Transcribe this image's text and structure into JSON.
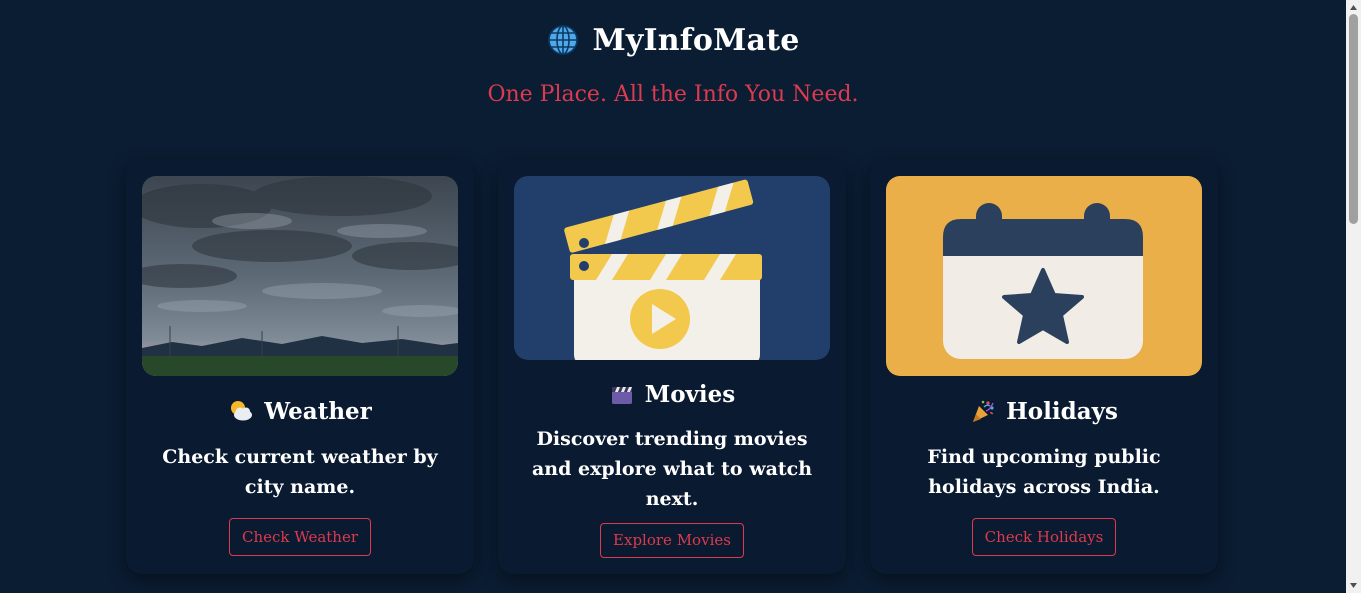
{
  "header": {
    "icon": "globe-icon",
    "title": "MyInfoMate",
    "tagline": "One Place. All the Info You Need."
  },
  "cards": [
    {
      "image": "cloudy-sky-landscape-photo",
      "icon": "sun-behind-cloud-icon",
      "title": "Weather",
      "description": "Check current weather by city name.",
      "button": "Check Weather"
    },
    {
      "image": "clapperboard-illustration",
      "icon": "clapper-board-icon",
      "title": "Movies",
      "description": "Discover trending movies and explore what to watch next.",
      "button": "Explore Movies"
    },
    {
      "image": "calendar-star-illustration",
      "icon": "party-popper-icon",
      "title": "Holidays",
      "description": "Find upcoming public holidays across India.",
      "button": "Check Holidays"
    }
  ],
  "colors": {
    "background": "#0b1d33",
    "card": "#0a1a30",
    "accent": "#dc3a4e",
    "movies_bg": "#223e6b",
    "holidays_bg": "#eaaf48"
  }
}
